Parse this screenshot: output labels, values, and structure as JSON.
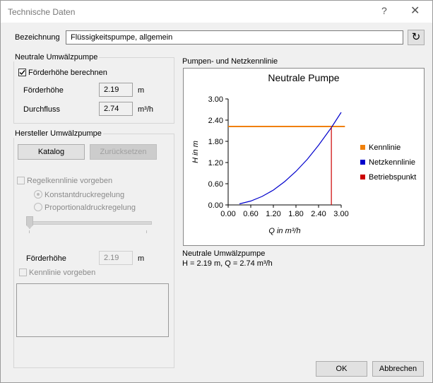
{
  "window": {
    "title": "Technische Daten",
    "help_label": "?",
    "close_label": "✕"
  },
  "bezeichnung": {
    "label": "Bezeichnung",
    "value": "Flüssigkeitspumpe, allgemein"
  },
  "neutral_pump": {
    "group_label": "Neutrale Umwälzpumpe",
    "calc_label": "Förderhöhe berechnen",
    "calc_checked": true,
    "head_label": "Förderhöhe",
    "head_value": "2.19",
    "head_unit": "m",
    "flow_label": "Durchfluss",
    "flow_value": "2.74",
    "flow_unit": "m³/h"
  },
  "manufacturer": {
    "group_label": "Hersteller Umwälzpumpe",
    "catalog_button": "Katalog",
    "reset_button": "Zurücksetzen",
    "regel_label": "Regelkennlinie vorgeben",
    "constant_label": "Konstantdruckregelung",
    "proportional_label": "Proportionaldruckregelung",
    "head_label": "Förderhöhe",
    "head_value": "2.19",
    "head_unit": "m",
    "kennlinie_label": "Kennlinie vorgeben"
  },
  "chart_section": {
    "label": "Pumpen- und Netzkennlinie"
  },
  "chart_data": {
    "type": "line",
    "title": "Neutrale Pumpe",
    "xlabel": "Q in m³/h",
    "ylabel": "H in m",
    "xlim": [
      0,
      3.0
    ],
    "ylim": [
      0,
      3.0
    ],
    "x_ticks": [
      "0.00",
      "0.60",
      "1.20",
      "1.80",
      "2.40",
      "3.00"
    ],
    "y_ticks": [
      "0.00",
      "0.60",
      "1.20",
      "1.80",
      "2.40",
      "3.00"
    ],
    "legend_position": "right",
    "series": [
      {
        "name": "Kennlinie",
        "color": "#f0800a",
        "x": [
          0.0,
          3.1
        ],
        "y": [
          2.22,
          2.22
        ]
      },
      {
        "name": "Netzkennlinie",
        "color": "#0000cc",
        "x": [
          0.3,
          0.6,
          0.9,
          1.2,
          1.5,
          1.8,
          2.1,
          2.4,
          2.74,
          3.0
        ],
        "y": [
          0.03,
          0.11,
          0.24,
          0.42,
          0.66,
          0.95,
          1.29,
          1.69,
          2.19,
          2.62
        ]
      },
      {
        "name": "Betriebspunkt",
        "color": "#cc0000",
        "x": [
          2.74,
          2.74
        ],
        "y": [
          0.0,
          2.19
        ]
      }
    ]
  },
  "result": {
    "title": "Neutrale Umwälzpumpe",
    "summary": "H = 2.19 m, Q = 2.74 m³/h"
  },
  "buttons": {
    "ok": "OK",
    "cancel": "Abbrechen"
  }
}
